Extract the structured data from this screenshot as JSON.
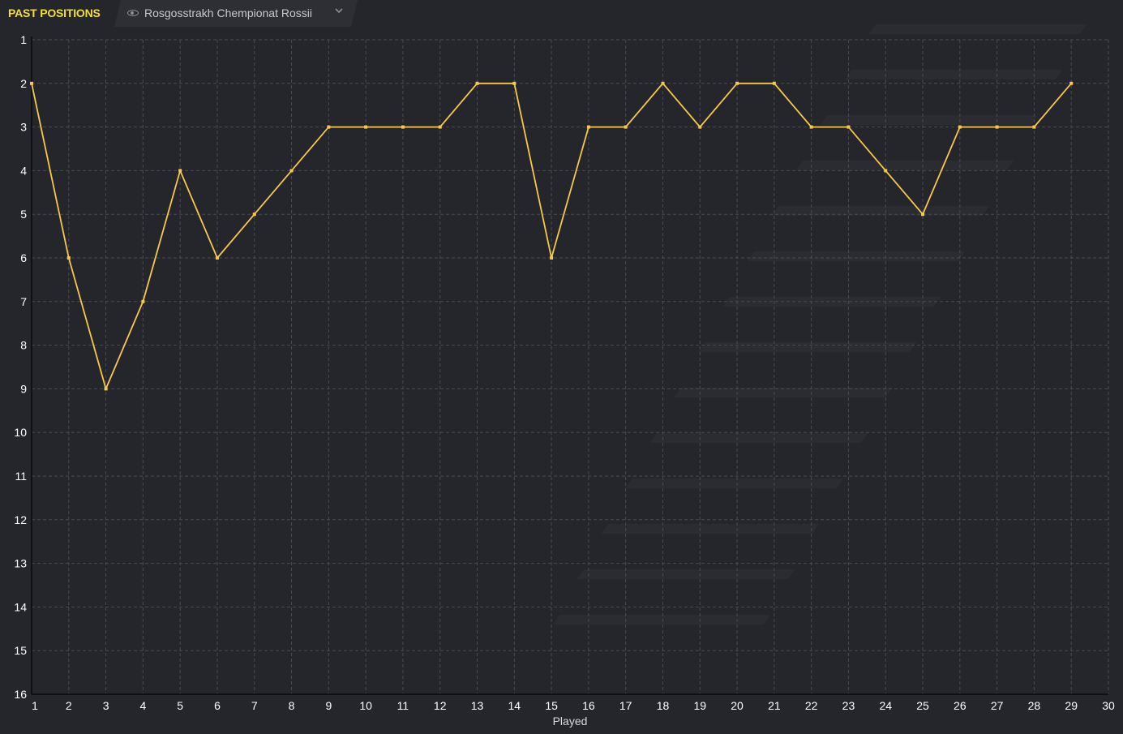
{
  "header": {
    "title": "PAST POSITIONS",
    "competition": "Rosgosstrakh Chempionat Rossii"
  },
  "colors": {
    "accent": "#f2df3a",
    "line": "#f5c94a",
    "background": "#25262b",
    "grid": "#4a4b50"
  },
  "icons": {
    "visibility": "eye-icon",
    "dropdown": "chevron-down-icon"
  },
  "chart_data": {
    "type": "line",
    "title": "",
    "xlabel": "Played",
    "ylabel": "",
    "xlim": [
      1,
      30
    ],
    "ylim": [
      1,
      16
    ],
    "y_inverted": true,
    "grid": true,
    "x_ticks": [
      1,
      2,
      3,
      4,
      5,
      6,
      7,
      8,
      9,
      10,
      11,
      12,
      13,
      14,
      15,
      16,
      17,
      18,
      19,
      20,
      21,
      22,
      23,
      24,
      25,
      26,
      27,
      28,
      29,
      30
    ],
    "y_ticks": [
      1,
      2,
      3,
      4,
      5,
      6,
      7,
      8,
      9,
      10,
      11,
      12,
      13,
      14,
      15,
      16
    ],
    "series": [
      {
        "x": [
          1,
          2,
          3,
          4,
          5,
          6,
          7,
          8,
          9,
          10,
          11,
          12,
          13,
          14,
          15,
          16,
          17,
          18,
          19,
          20,
          21,
          22,
          23,
          24,
          25,
          26,
          27,
          28,
          29
        ],
        "values": [
          2,
          6,
          9,
          7,
          4,
          6,
          5,
          4,
          3,
          3,
          3,
          3,
          2,
          2,
          6,
          3,
          3,
          2,
          3,
          2,
          2,
          3,
          3,
          4,
          5,
          3,
          3,
          3,
          2
        ]
      }
    ]
  }
}
